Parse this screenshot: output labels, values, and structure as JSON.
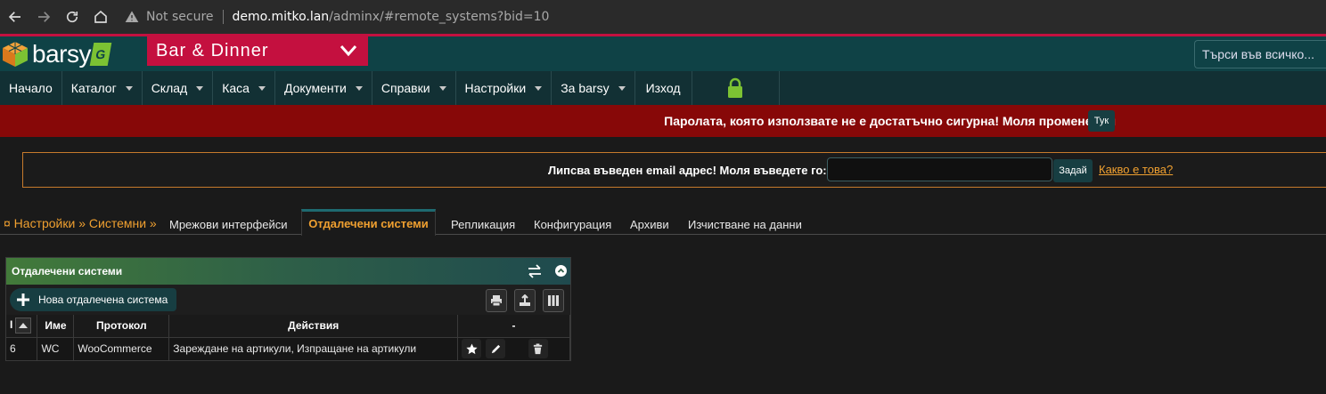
{
  "browser": {
    "not_secure": "Not secure",
    "url_host": "demo.mitko.lan",
    "url_path": "/adminx/#remote_systems?bid=10"
  },
  "header": {
    "logo_text": "barsy",
    "logo_badge": "G",
    "company": "Bar & Dinner",
    "search_placeholder": "Търси във всичко..."
  },
  "menu": {
    "items": [
      {
        "label": "Начало"
      },
      {
        "label": "Каталог"
      },
      {
        "label": "Склад"
      },
      {
        "label": "Каса"
      },
      {
        "label": "Документи"
      },
      {
        "label": "Справки"
      },
      {
        "label": "Настройки"
      },
      {
        "label": "За barsy"
      },
      {
        "label": "Изход"
      }
    ]
  },
  "password_warning": {
    "text": "Паролата, която използвате не е достатъчно сигурна! Моля променете я",
    "button": "Тук"
  },
  "email_notice": {
    "text": "Липсва въведен email адрес! Моля въведете го:",
    "value": "",
    "submit": "Задай",
    "link": "Какво е това?"
  },
  "breadcrumb": "¤ Настройки » Системни »",
  "tabs": [
    {
      "label": "Мрежови интерфейси"
    },
    {
      "label": "Отдалечени системи",
      "active": true
    },
    {
      "label": "Репликация"
    },
    {
      "label": "Конфигурация"
    },
    {
      "label": "Архиви"
    },
    {
      "label": "Изчистване на данни"
    }
  ],
  "panel": {
    "title": "Отдалечени системи",
    "new_button": "Нова отдалечена система",
    "columns": [
      "I",
      "Име",
      "Протокол",
      "Действия",
      "-"
    ],
    "rows": [
      {
        "id": "6",
        "name": "WC",
        "protocol": "WooCommerce",
        "actions": "Зареждане на артикули, Изпращане на артикули"
      }
    ]
  },
  "colors": {
    "accent_red": "#c4103f",
    "header_teal": "#0f4246",
    "warning_bar": "#870808",
    "link_orange": "#f0a030"
  }
}
